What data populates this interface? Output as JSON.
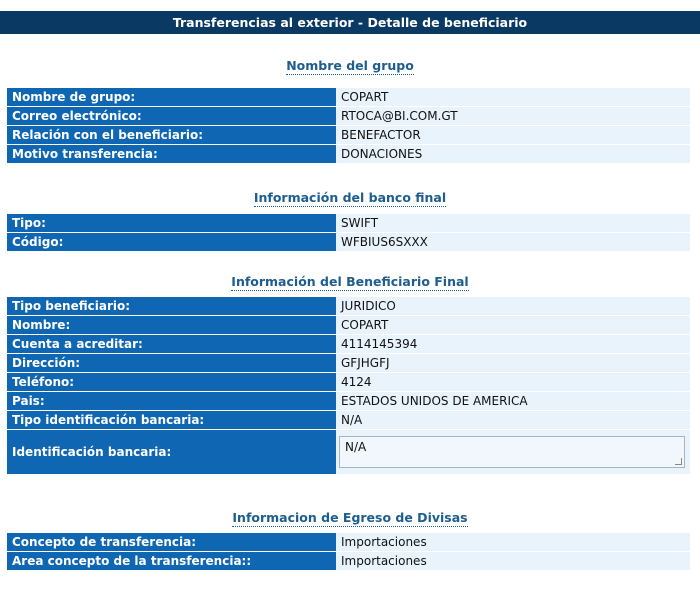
{
  "header": {
    "title": "Transferencias al exterior - Detalle de beneficiario"
  },
  "sections": [
    {
      "title": "Nombre del grupo",
      "rows": [
        {
          "label": "Nombre de grupo:",
          "value": "COPART"
        },
        {
          "label": "Correo electrónico:",
          "value": "RTOCA@BI.COM.GT"
        },
        {
          "label": "Relación con el beneficiario:",
          "value": "BENEFACTOR"
        },
        {
          "label": "Motivo transferencia:",
          "value": "DONACIONES"
        }
      ]
    },
    {
      "title": "Información del banco final",
      "rows": [
        {
          "label": "Tipo:",
          "value": "SWIFT"
        },
        {
          "label": "Código:",
          "value": "WFBIUS6SXXX"
        }
      ]
    },
    {
      "title": "Información del Beneficiario Final",
      "rows": [
        {
          "label": "Tipo beneficiario:",
          "value": "JURIDICO"
        },
        {
          "label": "Nombre:",
          "value": "COPART"
        },
        {
          "label": "Cuenta a acreditar:",
          "value": "4114145394"
        },
        {
          "label": "Dirección:",
          "value": "GFJHGFJ"
        },
        {
          "label": "Teléfono:",
          "value": "4124"
        },
        {
          "label": "Pais:",
          "value": "ESTADOS UNIDOS DE AMERICA"
        },
        {
          "label": "Tipo identificación bancaria:",
          "value": "N/A"
        },
        {
          "label": "Identificación bancaria:",
          "value": "N/A"
        }
      ]
    },
    {
      "title": "Informacion de Egreso de Divisas",
      "rows": [
        {
          "label": "Concepto de transferencia:",
          "value": "Importaciones"
        },
        {
          "label": "Area concepto de la transferencia::",
          "value": "Importaciones"
        }
      ]
    }
  ]
}
